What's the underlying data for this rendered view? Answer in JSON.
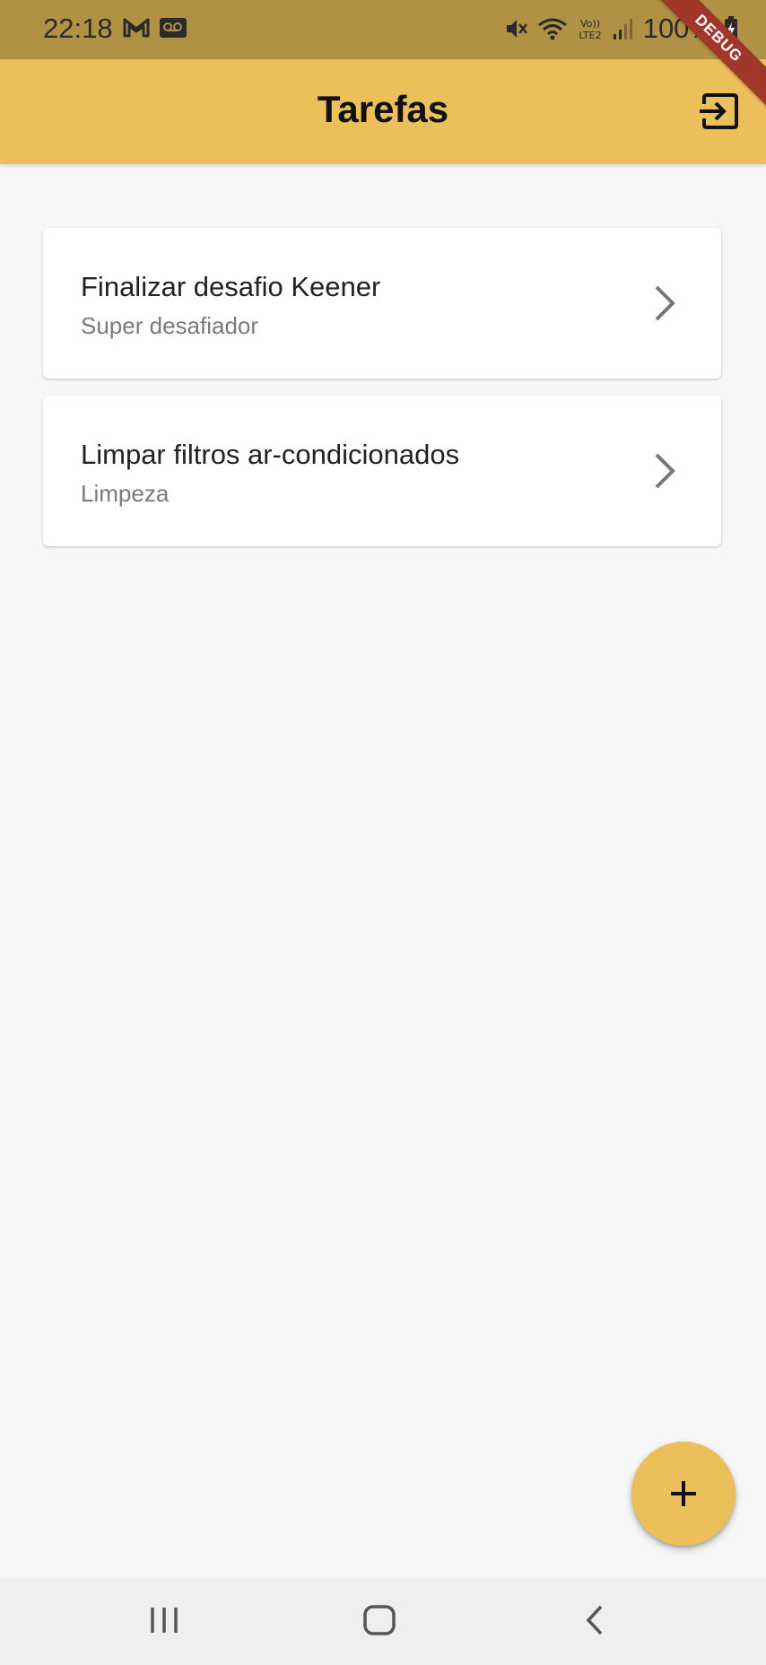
{
  "status_bar": {
    "time": "22:18",
    "battery": "100%",
    "left_icons": [
      "gmail-icon",
      "voicemail-icon"
    ],
    "right_icons": [
      "mute-icon",
      "wifi-icon",
      "volte-icon",
      "signal-icon",
      "battery-charging-icon"
    ]
  },
  "debug_banner": "DEBUG",
  "app_bar": {
    "title": "Tarefas",
    "action_icon": "exit-icon"
  },
  "tasks": [
    {
      "title": "Finalizar desafio Keener",
      "subtitle": "Super desafiador"
    },
    {
      "title": "Limpar filtros ar-condicionados",
      "subtitle": "Limpeza"
    }
  ],
  "fab": {
    "icon": "plus-icon"
  },
  "nav_bar": {
    "icons": [
      "recents-icon",
      "home-icon",
      "back-icon"
    ]
  },
  "colors": {
    "app_bar": "#ebbf5a",
    "status_bar": "#b19143",
    "background": "#f7f7f7",
    "debug_banner": "#a2362a"
  }
}
